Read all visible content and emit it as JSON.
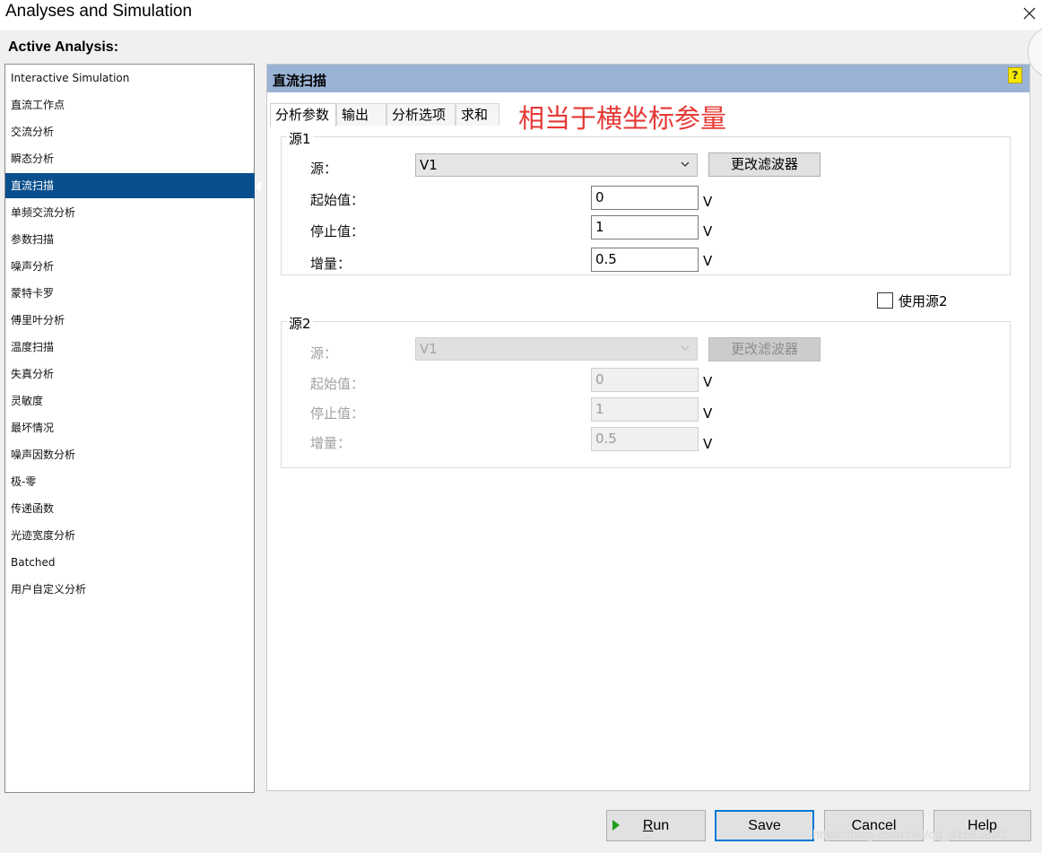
{
  "window": {
    "title": "Analyses and Simulation"
  },
  "active_analysis_label": "Active Analysis:",
  "analyses": [
    "Interactive Simulation",
    "直流工作点",
    "交流分析",
    "瞬态分析",
    "直流扫描",
    "单频交流分析",
    "参数扫描",
    "噪声分析",
    "蒙特卡罗",
    "傅里叶分析",
    "温度扫描",
    "失真分析",
    "灵敏度",
    "最坏情况",
    "噪声因数分析",
    "极-零",
    "传递函数",
    "光迹宽度分析",
    "Batched",
    "用户自定义分析"
  ],
  "selected_analysis_index": 4,
  "panel": {
    "title": "直流扫描",
    "help_icon": "?",
    "tabs": [
      "分析参数",
      "输出",
      "分析选项",
      "求和"
    ],
    "active_tab": 0,
    "annotation": "相当于横坐标参量"
  },
  "source1": {
    "title": "源1",
    "source_label": "源：",
    "source_value": "V1",
    "filter_button": "更改滤波器",
    "start_label": "起始值：",
    "start_value": "0",
    "stop_label": "停止值：",
    "stop_value": "1",
    "inc_label": "增量：",
    "inc_value": "0.5",
    "unit": "V"
  },
  "use_source2": {
    "label": "使用源2",
    "checked": false
  },
  "source2": {
    "title": "源2",
    "source_label": "源：",
    "source_value": "V1",
    "filter_button": "更改滤波器",
    "start_label": "起始值：",
    "start_value": "0",
    "stop_label": "停止值：",
    "stop_value": "1",
    "inc_label": "增量：",
    "inc_value": "0.5",
    "unit": "V"
  },
  "buttons": {
    "run_prefix": "R",
    "run_rest": "un",
    "save": "Save",
    "cancel": "Cancel",
    "help": "Help"
  },
  "watermark": "https://blog.csdn.net/qq_41663820",
  "colors": {
    "selection": "#0a4f8d",
    "header": "#9ab3d5",
    "annotation": "#e53935",
    "run_icon": "#1f9e1f"
  }
}
